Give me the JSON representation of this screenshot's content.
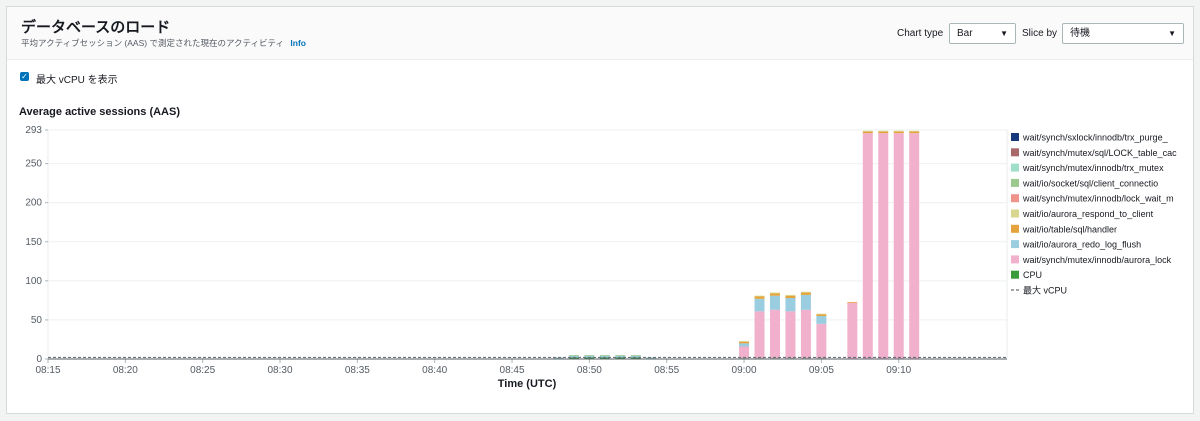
{
  "header": {
    "title": "データベースのロード",
    "subtitle": "平均アクティブセッション (AAS) で測定された現在のアクティビティ",
    "info_link": "Info",
    "chart_type_label": "Chart type",
    "chart_type_value": "Bar",
    "slice_by_label": "Slice by",
    "slice_by_value": "待機"
  },
  "options": {
    "max_vcpu_checkbox_label": "最大 vCPU を表示",
    "max_vcpu_checked": true
  },
  "colors": {
    "wait/synch/sxlock/innodb/trx_purge_": "#16387e",
    "wait/synch/mutex/sql/LOCK_table_cac": "#a86a6a",
    "wait/synch/mutex/innodb/trx_mutex": "#9fdfc7",
    "wait/io/socket/sql/client_connectio": "#9cc98e",
    "wait/synch/mutex/innodb/lock_wait_m": "#f0938a",
    "wait/io/aurora_respond_to_client": "#d9d68f",
    "wait/io/table/sql/handler": "#e5a43b",
    "wait/io/aurora_redo_log_flush": "#9acde0",
    "wait/synch/mutex/innodb/aurora_lock": "#f1b1cc",
    "CPU": "#3a9b3a",
    "max_vcpu_line": "#6b7176"
  },
  "chart_data": {
    "type": "bar",
    "stacked": true,
    "title": "Average active sessions (AAS)",
    "xlabel": "Time (UTC)",
    "ylabel": "",
    "ylim": [
      0,
      293
    ],
    "yticks": [
      0,
      50,
      100,
      150,
      200,
      250,
      293
    ],
    "xlim": [
      "08:15",
      "09:17"
    ],
    "xticks": [
      "08:15",
      "08:20",
      "08:25",
      "08:30",
      "08:35",
      "08:40",
      "08:45",
      "08:50",
      "08:55",
      "09:00",
      "09:05",
      "09:10"
    ],
    "max_vcpu": 2,
    "legend_position": "right",
    "x": [
      "08:48",
      "08:49",
      "08:50",
      "08:51",
      "08:52",
      "08:53",
      "08:54",
      "08:55",
      "08:56",
      "08:57",
      "08:58",
      "08:59",
      "09:00",
      "09:01",
      "09:02",
      "09:03",
      "09:04",
      "09:05",
      "09:06",
      "09:07",
      "09:08",
      "09:09",
      "09:10",
      "09:11"
    ],
    "series": [
      {
        "name": "CPU",
        "values": [
          1,
          2,
          2,
          2,
          2,
          2,
          1,
          0,
          0,
          0,
          0,
          0,
          1,
          1,
          1,
          1,
          1,
          1,
          0,
          0,
          0,
          0,
          0,
          0
        ]
      },
      {
        "name": "wait/synch/mutex/innodb/aurora_lock",
        "values": [
          0,
          0,
          0,
          0,
          0,
          0,
          0,
          0,
          0,
          0,
          0,
          0,
          15,
          60,
          62,
          60,
          62,
          44,
          0,
          72,
          289,
          289,
          289,
          289
        ]
      },
      {
        "name": "wait/io/aurora_redo_log_flush",
        "values": [
          1,
          2,
          2,
          2,
          2,
          2,
          1,
          0,
          0,
          0,
          0,
          0,
          4,
          16,
          18,
          17,
          19,
          10,
          0,
          0,
          0,
          0,
          0,
          0
        ]
      },
      {
        "name": "wait/io/table/sql/handler",
        "values": [
          0,
          0,
          0,
          0,
          0,
          0,
          0,
          0,
          0,
          0,
          0,
          0,
          2,
          3,
          3,
          3,
          3,
          2,
          0,
          1,
          2,
          2,
          2,
          2
        ]
      },
      {
        "name": "wait/io/aurora_respond_to_client",
        "values": [
          0,
          0,
          0,
          0,
          0,
          0,
          0,
          0,
          0,
          0,
          0,
          0,
          1,
          1,
          1,
          1,
          1,
          1,
          0,
          0,
          1,
          1,
          1,
          1
        ]
      },
      {
        "name": "wait/synch/mutex/innodb/lock_wait_m",
        "values": [
          0,
          0,
          0,
          0,
          0,
          0,
          0,
          0,
          0,
          0,
          0,
          0,
          0,
          0,
          0,
          0,
          0,
          0,
          0,
          0,
          0,
          0,
          0,
          0
        ]
      },
      {
        "name": "wait/io/socket/sql/client_connectio",
        "values": [
          0,
          1,
          1,
          1,
          1,
          1,
          0,
          0,
          0,
          0,
          0,
          0,
          0,
          0,
          0,
          0,
          0,
          0,
          0,
          0,
          0,
          0,
          0,
          0
        ]
      },
      {
        "name": "wait/synch/mutex/innodb/trx_mutex",
        "values": [
          0,
          0,
          0,
          0,
          0,
          0,
          0,
          0,
          0,
          0,
          0,
          0,
          0,
          0,
          0,
          0,
          0,
          0,
          0,
          0,
          0,
          0,
          0,
          0
        ]
      },
      {
        "name": "wait/synch/mutex/sql/LOCK_table_cac",
        "values": [
          0,
          0,
          0,
          0,
          0,
          0,
          0,
          0,
          0,
          0,
          0,
          0,
          0,
          0,
          0,
          0,
          0,
          0,
          0,
          0,
          0,
          0,
          0,
          0
        ]
      },
      {
        "name": "wait/synch/sxlock/innodb/trx_purge_",
        "values": [
          0,
          0,
          0,
          0,
          0,
          0,
          0,
          0,
          0,
          0,
          0,
          0,
          0,
          0,
          0,
          0,
          0,
          0,
          0,
          0,
          0,
          0,
          0,
          0
        ]
      }
    ],
    "legend": [
      "wait/synch/sxlock/innodb/trx_purge_",
      "wait/synch/mutex/sql/LOCK_table_cac",
      "wait/synch/mutex/innodb/trx_mutex",
      "wait/io/socket/sql/client_connectio",
      "wait/synch/mutex/innodb/lock_wait_m",
      "wait/io/aurora_respond_to_client",
      "wait/io/table/sql/handler",
      "wait/io/aurora_redo_log_flush",
      "wait/synch/mutex/innodb/aurora_lock",
      "CPU"
    ],
    "legend_extra": {
      "label": "最大 vCPU",
      "style": "dashed"
    }
  }
}
